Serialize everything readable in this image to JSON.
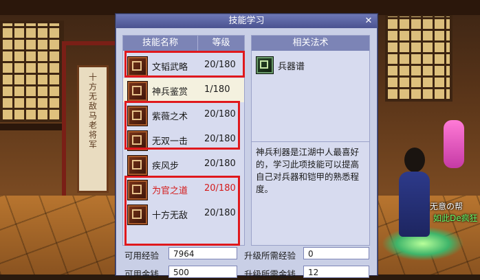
{
  "dialog": {
    "title": "技能学习",
    "close_label": "✕"
  },
  "skills_panel": {
    "header_name": "技能名称",
    "header_level": "等级",
    "skills": [
      {
        "name": "文韬武略",
        "level": "20/180",
        "icon": "book-icon",
        "selected": false,
        "highlight": false
      },
      {
        "name": "神兵鉴赏",
        "level": "1/180",
        "icon": "weapon-icon",
        "selected": true,
        "highlight": false
      },
      {
        "name": "紫薇之术",
        "level": "20/180",
        "icon": "star-icon",
        "selected": false,
        "highlight": false
      },
      {
        "name": "无双一击",
        "level": "20/180",
        "icon": "strike-icon",
        "selected": false,
        "highlight": false
      },
      {
        "name": "疾风步",
        "level": "20/180",
        "icon": "wind-icon",
        "selected": false,
        "highlight": false
      },
      {
        "name": "为官之道",
        "level": "20/180",
        "icon": "seal-icon",
        "selected": false,
        "highlight": true
      },
      {
        "name": "十方无敌",
        "level": "20/180",
        "icon": "cross-blade-icon",
        "selected": false,
        "highlight": false
      }
    ]
  },
  "related_panel": {
    "header": "相关法术",
    "item_name": "兵器谱",
    "item_icon": "scroll-icon"
  },
  "description": "神兵利器是江湖中人最喜好的，学习此项技能可以提高自己对兵器和铠甲的熟悉程度。",
  "stats": {
    "exp_label": "可用经验",
    "exp_value": "7964",
    "money_label": "可用金钱",
    "money_value": "500",
    "upgrade_exp_label": "升级所需经验",
    "upgrade_exp_value": "0",
    "upgrade_money_label": "升级所需金钱",
    "upgrade_money_value": "12"
  },
  "scene": {
    "sign_text": "十方无敌马老将军",
    "npc_name_1": "无意の帮",
    "npc_name_2": "如此De疯狂"
  },
  "colors": {
    "highlight_red": "#e0181c",
    "text_red": "#d41a1a",
    "header_blue": "#7c84b6"
  }
}
